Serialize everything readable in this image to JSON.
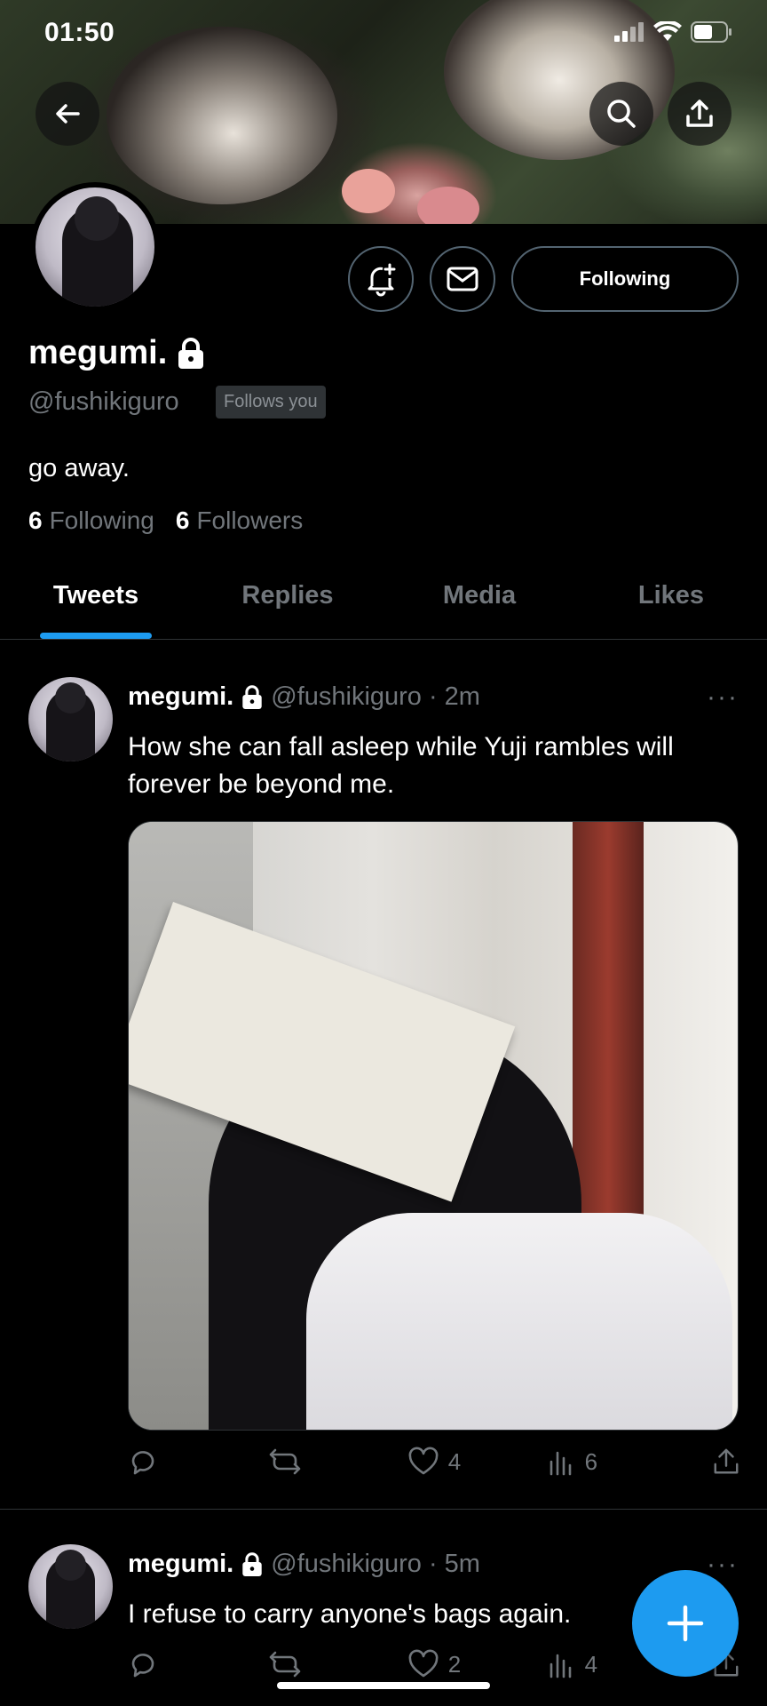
{
  "status_bar": {
    "time": "01:50"
  },
  "header": {
    "back_icon": "arrow-left-icon",
    "search_icon": "search-icon",
    "share_icon": "share-icon"
  },
  "profile": {
    "name": "megumi.",
    "handle": "@fushikiguro",
    "follows_you": "Follows you",
    "bio": "go away.",
    "following_count": "6",
    "following_label": "Following",
    "followers_count": "6",
    "followers_label": "Followers",
    "follow_button": "Following",
    "accent_color": "#1d9bf0"
  },
  "tabs": [
    {
      "label": "Tweets",
      "active": true
    },
    {
      "label": "Replies",
      "active": false
    },
    {
      "label": "Media",
      "active": false
    },
    {
      "label": "Likes",
      "active": false
    }
  ],
  "tweets": [
    {
      "name": "megumi.",
      "handle": "@fushikiguro",
      "time": "· 2m",
      "text": "How she can fall asleep while Yuji rambles will forever be beyond me.",
      "has_image": true,
      "likes": "4",
      "views": "6"
    },
    {
      "name": "megumi.",
      "handle": "@fushikiguro",
      "time": "· 5m",
      "text": "I refuse to carry anyone's bags again.",
      "has_image": false,
      "likes": "2",
      "views": "4"
    }
  ],
  "fab": {
    "icon": "plus-icon"
  }
}
